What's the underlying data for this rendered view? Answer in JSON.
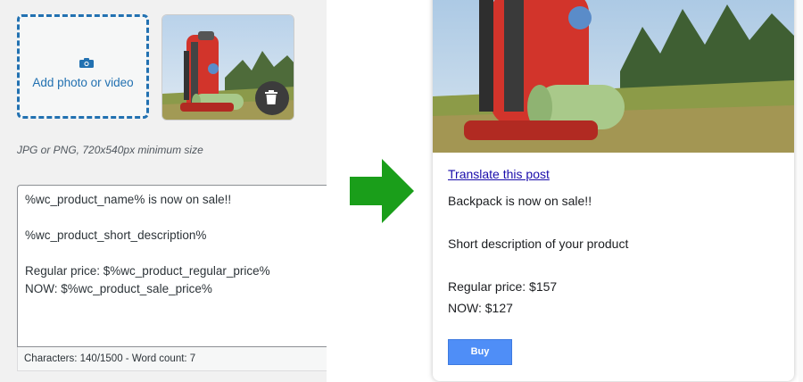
{
  "editor": {
    "add_media_label": "Add photo or video",
    "image_hint": "JPG or PNG, 720x540px minimum size",
    "message_lines": [
      "%wc_product_name% is now on sale!!",
      "",
      "%wc_product_short_description%",
      "",
      "Regular price: $%wc_product_regular_price%",
      "NOW: $%wc_product_sale_price%"
    ],
    "counter": "Characters: 140/1500 - Word count: 7"
  },
  "preview": {
    "translate_link": "Translate this post",
    "line1": "Backpack is now on sale!!",
    "line2": "Short description of your product",
    "line3": "Regular price: $157",
    "line4": "NOW: $127",
    "buy_label": "Buy"
  },
  "colors": {
    "accent": "#2271b1",
    "arrow": "#1a9e1a",
    "buy_button": "#4f8ef7",
    "link": "#1a0dab"
  },
  "icons": [
    "camera-icon",
    "trash-icon",
    "arrow-right-icon"
  ]
}
